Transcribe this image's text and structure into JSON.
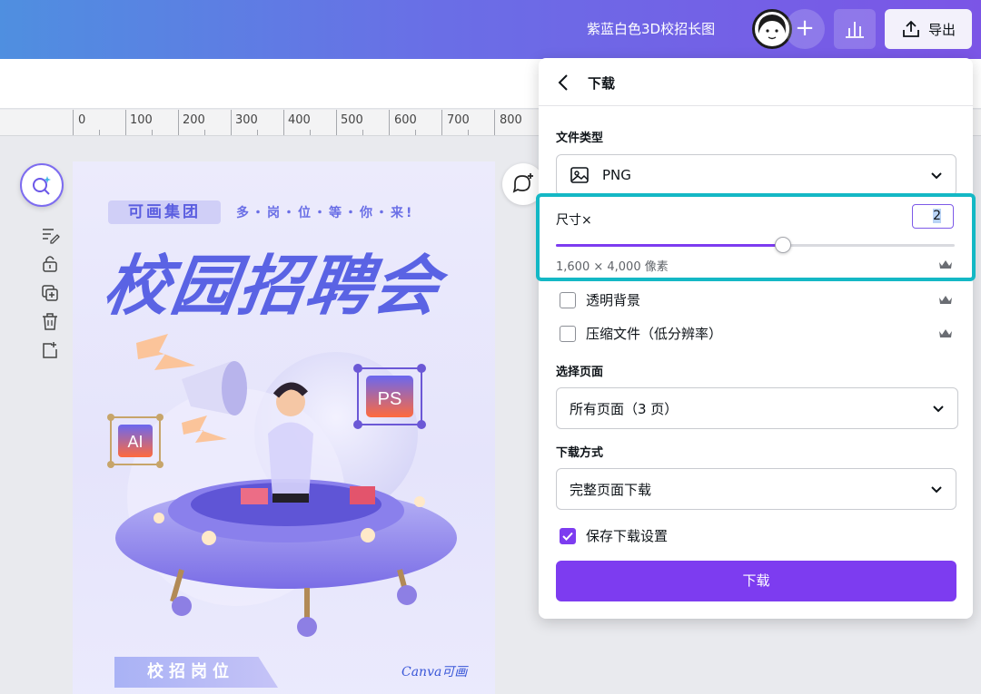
{
  "topbar": {
    "doc_title": "紫蓝白色3D校招长图",
    "plus_label": "+",
    "export_label": "导出"
  },
  "ruler": {
    "ticks": [
      "0",
      "100",
      "200",
      "300",
      "400",
      "500",
      "600",
      "700",
      "800"
    ]
  },
  "poster": {
    "badge": "可画集团",
    "slogan": "多・岗・位・等・你・来!",
    "headline": "校园招聘会",
    "ai_label": "AI",
    "ps_label": "PS",
    "section_tab": "校招岗位",
    "brand": "Canva可画"
  },
  "panel": {
    "title": "下载",
    "file_type_label": "文件类型",
    "file_type_value": "PNG",
    "size_label": "尺寸×",
    "size_value": "2",
    "size_slider_fraction": 0.57,
    "size_dimensions": "1,600 × 4,000 像素",
    "transparent_bg_label": "透明背景",
    "transparent_bg_checked": false,
    "compress_label": "压缩文件（低分辨率）",
    "compress_checked": false,
    "select_pages_label": "选择页面",
    "select_pages_value": "所有页面（3 页）",
    "download_method_label": "下载方式",
    "download_method_value": "完整页面下载",
    "save_settings_label": "保存下载设置",
    "save_settings_checked": true,
    "download_button": "下载"
  },
  "colors": {
    "accent": "#7d3cf0",
    "highlight": "#14b8c5",
    "headline": "#5a63e4"
  }
}
